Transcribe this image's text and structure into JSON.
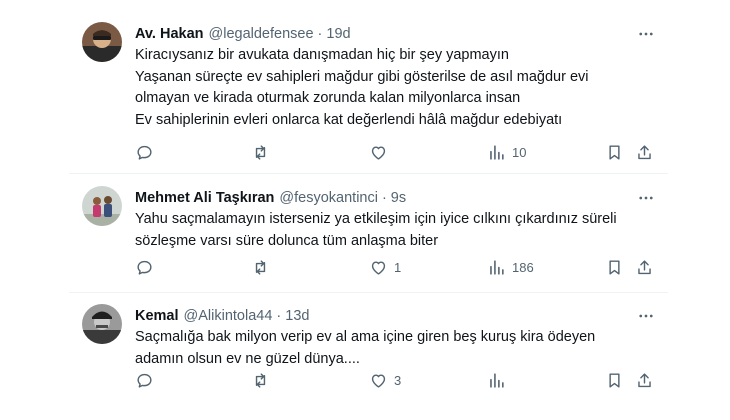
{
  "tweets": [
    {
      "name": "Av. Hakan",
      "handle": "@legaldefensee",
      "time": "19d",
      "lines": [
        "Kiracıysanız bir avukata danışmadan hiç bir şey yapmayın",
        "Yaşanan süreçte ev sahipleri mağdur gibi gösterilse de asıl mağdur evi",
        "olmayan ve kirada oturmak zorunda kalan milyonlarca insan",
        "Ev sahiplerinin evleri onlarca kat değerlendi hâlâ mağdur edebiyatı"
      ],
      "likes": "",
      "views": "10"
    },
    {
      "name": "Mehmet Ali Taşkıran",
      "handle": "@fesyokantinci",
      "time": "9s",
      "lines": [
        "Yahu saçmalamayın isterseniz ya etkileşim için iyice cılkını çıkardınız süreli",
        "sözleşme varsı süre dolunca tüm anlaşma biter"
      ],
      "likes": "1",
      "views": "186"
    },
    {
      "name": "Kemal",
      "handle": "@Alikintola44",
      "time": "13d",
      "lines": [
        "Saçmalığa bak milyon verip ev al ama içine giren beş kuruş kira ödeyen",
        "adamın olsun ev ne güzel dünya...."
      ],
      "likes": "3",
      "views": ""
    }
  ],
  "separator": "·",
  "colors": {
    "text": "#0f1419",
    "secondary": "#536471",
    "divider": "#eff3f4"
  },
  "icons": [
    "reply-icon",
    "retweet-icon",
    "like-icon",
    "views-icon",
    "bookmark-icon",
    "share-icon",
    "more-icon"
  ]
}
